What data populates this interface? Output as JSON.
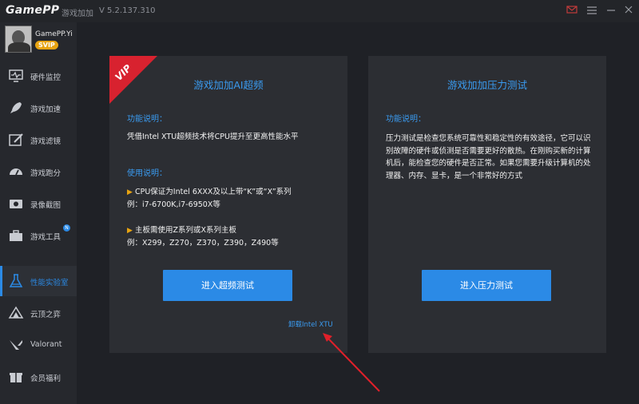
{
  "titlebar": {
    "logo": "GamePP",
    "app_name": "游戏加加",
    "version": "V 5.2.137.310"
  },
  "profile": {
    "username": "GamePP.Yi",
    "badge": "SVIP"
  },
  "sidebar": {
    "items": [
      {
        "label": "硬件监控",
        "icon": "hardware-monitor-icon"
      },
      {
        "label": "游戏加速",
        "icon": "rocket-icon"
      },
      {
        "label": "游戏滤镜",
        "icon": "filter-icon"
      },
      {
        "label": "游戏跑分",
        "icon": "speedometer-icon"
      },
      {
        "label": "录像截图",
        "icon": "camera-icon"
      },
      {
        "label": "游戏工具",
        "icon": "toolbox-icon"
      },
      {
        "label": "性能实验室",
        "icon": "lab-flask-icon"
      },
      {
        "label": "云顶之弈",
        "icon": "tft-icon"
      },
      {
        "label": "Valorant",
        "icon": "valorant-icon"
      },
      {
        "label": "会员福利",
        "icon": "gift-icon"
      }
    ],
    "active_index": 6
  },
  "card_left": {
    "ribbon": "VIP",
    "title": "游戏加加AI超频",
    "func_label": "功能说明：",
    "func_desc": "凭借Intel XTU超频技术将CPU提升至更高性能水平",
    "usage_label": "使用说明：",
    "bullet1_line1": "CPU保证为Intel 6XXX及以上带“K”或“X”系列",
    "bullet1_line2": "例：i7-6700K,i7-6950X等",
    "bullet2_line1": "主板需使用Z系列或X系列主板",
    "bullet2_line2": "例：X299，Z270，Z370，Z390，Z490等",
    "button": "进入超频测试",
    "uninstall": "卸载Intel XTU"
  },
  "card_right": {
    "title": "游戏加加压力测试",
    "func_label": "功能说明：",
    "func_desc": "压力测试是检查您系统可靠性和稳定性的有效途径，它可以识别故障的硬件或侦测是否需要更好的散热。在刚购买新的计算机后，能检查您的硬件是否正常。如果您需要升级计算机的处理器、内存、显卡，是一个非常好的方式",
    "button": "进入压力测试"
  },
  "colors": {
    "accent": "#2b8ae6",
    "vip_red": "#d8222f",
    "gold": "#e8a412",
    "annotation_arrow": "#e0202a"
  }
}
